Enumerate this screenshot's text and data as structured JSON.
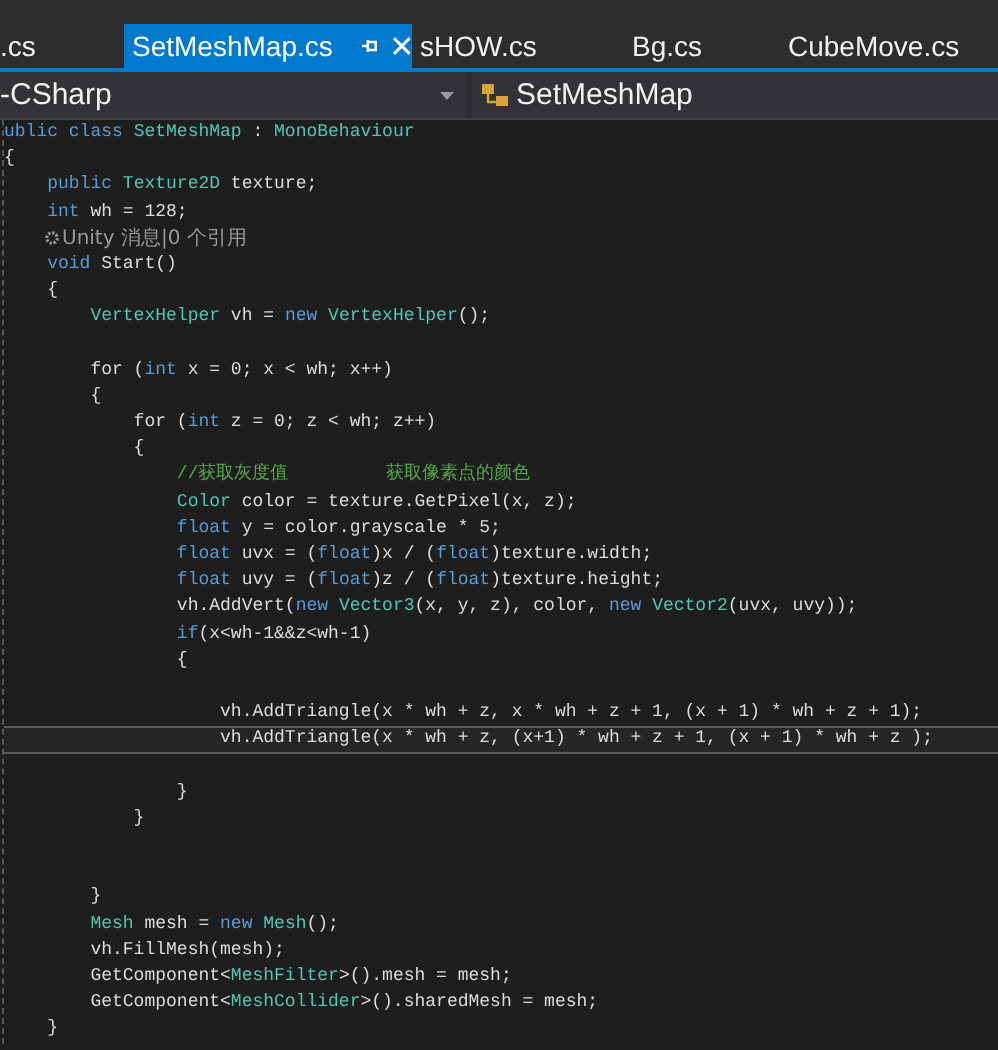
{
  "tabs": [
    {
      "label": ".cs",
      "selected": false
    },
    {
      "label": "SetMeshMap.cs",
      "selected": true
    },
    {
      "label": "sHOW.cs",
      "selected": false
    },
    {
      "label": "Bg.cs",
      "selected": false
    },
    {
      "label": "CubeMove.cs",
      "selected": false
    }
  ],
  "nav": {
    "project": "-CSharp",
    "class": "SetMeshMap"
  },
  "lines": [
    {
      "kind": "code",
      "current": false,
      "tokens": [
        {
          "kind": "keyword",
          "text": "ublic class "
        },
        {
          "kind": "type",
          "text": "SetMeshMap"
        },
        {
          "kind": "plain",
          "text": " : "
        },
        {
          "kind": "type",
          "text": "MonoBehaviour"
        }
      ]
    },
    {
      "kind": "code",
      "current": false,
      "tokens": [
        {
          "kind": "plain",
          "text": "{"
        }
      ]
    },
    {
      "kind": "code",
      "current": false,
      "tokens": [
        {
          "kind": "keyword",
          "text": "    public "
        },
        {
          "kind": "type",
          "text": "Texture2D"
        },
        {
          "kind": "plain",
          "text": " texture;"
        }
      ]
    },
    {
      "kind": "code",
      "current": false,
      "tokens": [
        {
          "kind": "keyword",
          "text": "    int"
        },
        {
          "kind": "plain",
          "text": " wh = 128;"
        }
      ]
    },
    {
      "kind": "codelens",
      "current": false,
      "text": "Unity 消息|0 个引用"
    },
    {
      "kind": "code",
      "current": false,
      "tokens": [
        {
          "kind": "keyword",
          "text": "    void"
        },
        {
          "kind": "plain",
          "text": " Start()"
        }
      ]
    },
    {
      "kind": "code",
      "current": false,
      "tokens": [
        {
          "kind": "plain",
          "text": "    {"
        }
      ]
    },
    {
      "kind": "code",
      "current": false,
      "tokens": [
        {
          "kind": "type",
          "text": "        VertexHelper"
        },
        {
          "kind": "plain",
          "text": " vh = "
        },
        {
          "kind": "keyword",
          "text": "new "
        },
        {
          "kind": "type",
          "text": "VertexHelper"
        },
        {
          "kind": "plain",
          "text": "();"
        }
      ]
    },
    {
      "kind": "code",
      "current": false
    },
    {
      "kind": "code",
      "current": false,
      "tokens": [
        {
          "kind": "plain",
          "text": "        for ("
        },
        {
          "kind": "keyword",
          "text": "int"
        },
        {
          "kind": "plain",
          "text": " x = 0; x < wh; x++)"
        }
      ]
    },
    {
      "kind": "code",
      "current": false,
      "tokens": [
        {
          "kind": "plain",
          "text": "        {"
        }
      ]
    },
    {
      "kind": "code",
      "current": false,
      "tokens": [
        {
          "kind": "plain",
          "text": "            for ("
        },
        {
          "kind": "keyword",
          "text": "int"
        },
        {
          "kind": "plain",
          "text": " z = 0; z < wh; z++)"
        }
      ]
    },
    {
      "kind": "code",
      "current": false,
      "tokens": [
        {
          "kind": "plain",
          "text": "            {"
        }
      ]
    },
    {
      "kind": "code",
      "current": false,
      "tokens": [
        {
          "kind": "comment",
          "text": "                //获取灰度值         获取像素点的颜色"
        }
      ]
    },
    {
      "kind": "code",
      "current": false,
      "tokens": [
        {
          "kind": "type",
          "text": "                Color"
        },
        {
          "kind": "plain",
          "text": " color = texture.GetPixel(x, z);"
        }
      ]
    },
    {
      "kind": "code",
      "current": false,
      "tokens": [
        {
          "kind": "keyword",
          "text": "                float"
        },
        {
          "kind": "plain",
          "text": " y = color.grayscale * 5;"
        }
      ]
    },
    {
      "kind": "code",
      "current": false,
      "tokens": [
        {
          "kind": "keyword",
          "text": "                float"
        },
        {
          "kind": "plain",
          "text": " uvx = ("
        },
        {
          "kind": "keyword",
          "text": "float"
        },
        {
          "kind": "plain",
          "text": ")x / ("
        },
        {
          "kind": "keyword",
          "text": "float"
        },
        {
          "kind": "plain",
          "text": ")texture.width;"
        }
      ]
    },
    {
      "kind": "code",
      "current": false,
      "tokens": [
        {
          "kind": "keyword",
          "text": "                float"
        },
        {
          "kind": "plain",
          "text": " uvy = ("
        },
        {
          "kind": "keyword",
          "text": "float"
        },
        {
          "kind": "plain",
          "text": ")z / ("
        },
        {
          "kind": "keyword",
          "text": "float"
        },
        {
          "kind": "plain",
          "text": ")texture.height;"
        }
      ]
    },
    {
      "kind": "code",
      "current": false,
      "tokens": [
        {
          "kind": "plain",
          "text": "                vh.AddVert("
        },
        {
          "kind": "keyword",
          "text": "new "
        },
        {
          "kind": "type",
          "text": "Vector3"
        },
        {
          "kind": "plain",
          "text": "(x, y, z), color, "
        },
        {
          "kind": "keyword",
          "text": "new "
        },
        {
          "kind": "type",
          "text": "Vector2"
        },
        {
          "kind": "plain",
          "text": "(uvx, uvy));"
        }
      ]
    },
    {
      "kind": "code",
      "current": false,
      "tokens": [
        {
          "kind": "keyword",
          "text": "                if"
        },
        {
          "kind": "plain",
          "text": "(x<wh-1&&z<wh-1)"
        }
      ]
    },
    {
      "kind": "code",
      "current": false,
      "tokens": [
        {
          "kind": "plain",
          "text": "                {"
        }
      ]
    },
    {
      "kind": "code",
      "current": false
    },
    {
      "kind": "code",
      "current": false,
      "tokens": [
        {
          "kind": "plain",
          "text": "                    vh.AddTriangle(x * wh + z, x * wh + z + 1, (x + 1) * wh + z + 1);"
        }
      ]
    },
    {
      "kind": "code",
      "current": true,
      "tokens": [
        {
          "kind": "plain",
          "text": "                    vh.AddTriangle(x * wh + z, (x+1) * wh + z + 1, (x + 1) * wh + z );"
        }
      ]
    },
    {
      "kind": "code",
      "current": false
    },
    {
      "kind": "code",
      "current": false,
      "tokens": [
        {
          "kind": "plain",
          "text": "                }"
        }
      ]
    },
    {
      "kind": "code",
      "current": false,
      "tokens": [
        {
          "kind": "plain",
          "text": "            }"
        }
      ]
    },
    {
      "kind": "code",
      "current": false
    },
    {
      "kind": "code",
      "current": false
    },
    {
      "kind": "code",
      "current": false,
      "tokens": [
        {
          "kind": "plain",
          "text": "        }"
        }
      ]
    },
    {
      "kind": "code",
      "current": false,
      "tokens": [
        {
          "kind": "type",
          "text": "        Mesh"
        },
        {
          "kind": "plain",
          "text": " mesh = "
        },
        {
          "kind": "keyword",
          "text": "new "
        },
        {
          "kind": "type",
          "text": "Mesh"
        },
        {
          "kind": "plain",
          "text": "();"
        }
      ]
    },
    {
      "kind": "code",
      "current": false,
      "tokens": [
        {
          "kind": "plain",
          "text": "        vh.FillMesh(mesh);"
        }
      ]
    },
    {
      "kind": "code",
      "current": false,
      "tokens": [
        {
          "kind": "plain",
          "text": "        GetComponent<"
        },
        {
          "kind": "type",
          "text": "MeshFilter"
        },
        {
          "kind": "plain",
          "text": ">().mesh = mesh;"
        }
      ]
    },
    {
      "kind": "code",
      "current": false,
      "tokens": [
        {
          "kind": "plain",
          "text": "        GetComponent<"
        },
        {
          "kind": "type",
          "text": "MeshCollider"
        },
        {
          "kind": "plain",
          "text": ">().sharedMesh = mesh;"
        }
      ]
    },
    {
      "kind": "code",
      "current": false,
      "tokens": [
        {
          "kind": "plain",
          "text": "    }"
        }
      ]
    }
  ]
}
